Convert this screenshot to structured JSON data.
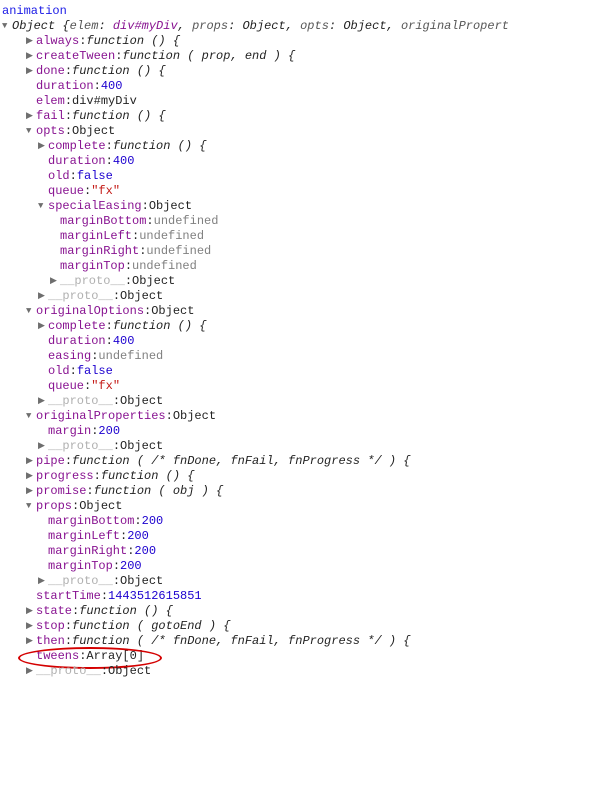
{
  "header": "animation",
  "summary": {
    "type": "Object",
    "open": "{",
    "elem_k": "elem",
    "elem_v": "div#myDiv",
    "props_k": "props",
    "props_v": "Object",
    "opts_k": "opts",
    "opts_v": "Object",
    "orig_k": "originalPropert"
  },
  "rows": [
    {
      "d": 2,
      "a": "▶",
      "k": "always",
      "v": "function () {",
      "t": "func"
    },
    {
      "d": 2,
      "a": "▶",
      "k": "createTween",
      "v": "function ( prop, end ) {",
      "t": "func"
    },
    {
      "d": 2,
      "a": "▶",
      "k": "done",
      "v": "function () {",
      "t": "func"
    },
    {
      "d": 2,
      "a": "",
      "k": "duration",
      "v": "400",
      "t": "num"
    },
    {
      "d": 2,
      "a": "",
      "k": "elem",
      "v": "div#myDiv",
      "t": "val"
    },
    {
      "d": 2,
      "a": "▶",
      "k": "fail",
      "v": "function () {",
      "t": "func"
    },
    {
      "d": 2,
      "a": "▼",
      "k": "opts",
      "v": "Object",
      "t": "val"
    },
    {
      "d": 3,
      "a": "▶",
      "k": "complete",
      "v": "function () {",
      "t": "func"
    },
    {
      "d": 3,
      "a": "",
      "k": "duration",
      "v": "400",
      "t": "num"
    },
    {
      "d": 3,
      "a": "",
      "k": "old",
      "v": "false",
      "t": "num"
    },
    {
      "d": 3,
      "a": "",
      "k": "queue",
      "v": "\"fx\"",
      "t": "str"
    },
    {
      "d": 3,
      "a": "▼",
      "k": "specialEasing",
      "v": "Object",
      "t": "val"
    },
    {
      "d": 4,
      "a": "",
      "k": "marginBottom",
      "v": "undefined",
      "t": "undef"
    },
    {
      "d": 4,
      "a": "",
      "k": "marginLeft",
      "v": "undefined",
      "t": "undef"
    },
    {
      "d": 4,
      "a": "",
      "k": "marginRight",
      "v": "undefined",
      "t": "undef"
    },
    {
      "d": 4,
      "a": "",
      "k": "marginTop",
      "v": "undefined",
      "t": "undef"
    },
    {
      "d": 4,
      "a": "▶",
      "k": "__proto__",
      "v": "Object",
      "t": "val",
      "proto": true
    },
    {
      "d": 3,
      "a": "▶",
      "k": "__proto__",
      "v": "Object",
      "t": "val",
      "proto": true
    },
    {
      "d": 2,
      "a": "▼",
      "k": "originalOptions",
      "v": "Object",
      "t": "val"
    },
    {
      "d": 3,
      "a": "▶",
      "k": "complete",
      "v": "function () {",
      "t": "func"
    },
    {
      "d": 3,
      "a": "",
      "k": "duration",
      "v": "400",
      "t": "num"
    },
    {
      "d": 3,
      "a": "",
      "k": "easing",
      "v": "undefined",
      "t": "undef"
    },
    {
      "d": 3,
      "a": "",
      "k": "old",
      "v": "false",
      "t": "num"
    },
    {
      "d": 3,
      "a": "",
      "k": "queue",
      "v": "\"fx\"",
      "t": "str"
    },
    {
      "d": 3,
      "a": "▶",
      "k": "__proto__",
      "v": "Object",
      "t": "val",
      "proto": true
    },
    {
      "d": 2,
      "a": "▼",
      "k": "originalProperties",
      "v": "Object",
      "t": "val"
    },
    {
      "d": 3,
      "a": "",
      "k": "margin",
      "v": "200",
      "t": "num"
    },
    {
      "d": 3,
      "a": "▶",
      "k": "__proto__",
      "v": "Object",
      "t": "val",
      "proto": true
    },
    {
      "d": 2,
      "a": "▶",
      "k": "pipe",
      "v": "function ( /* fnDone, fnFail, fnProgress */ ) {",
      "t": "func"
    },
    {
      "d": 2,
      "a": "▶",
      "k": "progress",
      "v": "function () {",
      "t": "func"
    },
    {
      "d": 2,
      "a": "▶",
      "k": "promise",
      "v": "function ( obj ) {",
      "t": "func"
    },
    {
      "d": 2,
      "a": "▼",
      "k": "props",
      "v": "Object",
      "t": "val"
    },
    {
      "d": 3,
      "a": "",
      "k": "marginBottom",
      "v": "200",
      "t": "num"
    },
    {
      "d": 3,
      "a": "",
      "k": "marginLeft",
      "v": "200",
      "t": "num"
    },
    {
      "d": 3,
      "a": "",
      "k": "marginRight",
      "v": "200",
      "t": "num"
    },
    {
      "d": 3,
      "a": "",
      "k": "marginTop",
      "v": "200",
      "t": "num"
    },
    {
      "d": 3,
      "a": "▶",
      "k": "__proto__",
      "v": "Object",
      "t": "val",
      "proto": true
    },
    {
      "d": 2,
      "a": "",
      "k": "startTime",
      "v": "1443512615851",
      "t": "num"
    },
    {
      "d": 2,
      "a": "▶",
      "k": "state",
      "v": "function () {",
      "t": "func"
    },
    {
      "d": 2,
      "a": "▶",
      "k": "stop",
      "v": "function ( gotoEnd ) {",
      "t": "func"
    },
    {
      "d": 2,
      "a": "▶",
      "k": "then",
      "v": "function ( /* fnDone, fnFail, fnProgress */ ) {",
      "t": "func"
    },
    {
      "d": 2,
      "a": "",
      "k": "tweens",
      "v": "Array[0]",
      "t": "val",
      "circle": true
    },
    {
      "d": 2,
      "a": "▶",
      "k": "__proto__",
      "v": "Object",
      "t": "val",
      "proto": true
    }
  ]
}
